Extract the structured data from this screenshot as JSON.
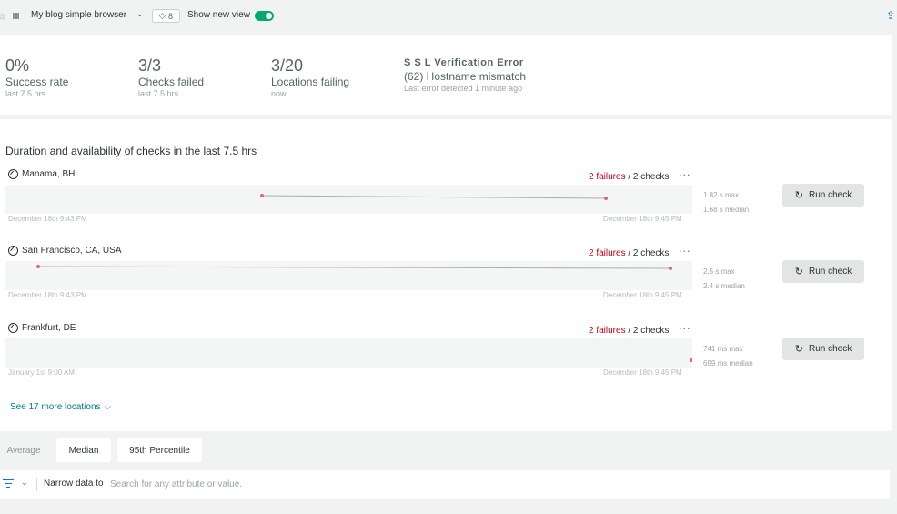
{
  "topbar": {
    "entity_name": "My blog simple browser",
    "tag_count": "8",
    "new_view_label": "Show new view"
  },
  "summary": {
    "success": {
      "value": "0%",
      "label": "Success rate",
      "sub": "last 7.5 hrs"
    },
    "checks_failed": {
      "value": "3/3",
      "label": "Checks failed",
      "sub": "last 7.5 hrs"
    },
    "locations_failing": {
      "value": "3/20",
      "label": "Locations failing",
      "sub": "now"
    },
    "error": {
      "title": "S S L Verification Error",
      "message": "(62) Hostname mismatch",
      "sub": "Last error detected 1 minute ago"
    }
  },
  "checks": {
    "title": "Duration and availability of checks in the last 7.5 hrs",
    "run_label": "Run check",
    "locations": [
      {
        "name": "Manama, BH",
        "failures": "2 failures",
        "checks": " / 2 checks",
        "axis_start": "December 18th 9:43 PM",
        "axis_end": "December 18th 9:45 PM",
        "max": "1.82 s max",
        "median": "1.68 s median"
      },
      {
        "name": "San Francisco, CA, USA",
        "failures": "2 failures",
        "checks": " / 2 checks",
        "axis_start": "December 18th 9:43 PM",
        "axis_end": "December 18th 9:45 PM",
        "max": "2.5 s max",
        "median": "2.4 s median"
      },
      {
        "name": "Frankfurt, DE",
        "failures": "2 failures",
        "checks": " / 2 checks",
        "axis_start": "January 1st 9:00 AM",
        "axis_end": "December 18th 9:45 PM",
        "max": "741 ms max",
        "median": "699 ms median"
      }
    ],
    "see_more": "See 17 more locations"
  },
  "aggregation": {
    "average": "Average",
    "median": "Median",
    "p95": "95th Percentile"
  },
  "filter": {
    "label": "Narrow data to",
    "placeholder": "Search for any attribute or value."
  },
  "colors": {
    "failure": "#bf0016",
    "toggle_on": "#00ac69",
    "link": "#007e8a"
  }
}
